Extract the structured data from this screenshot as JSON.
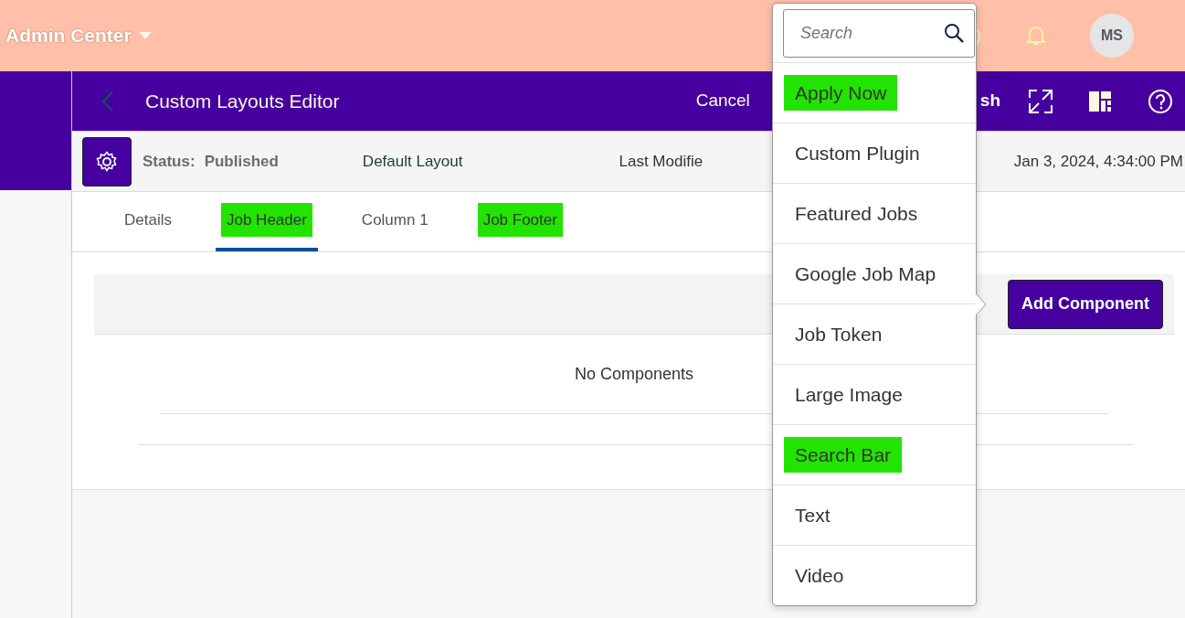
{
  "top_bar": {
    "title": "Admin Center",
    "avatar": "MS"
  },
  "editor_header": {
    "title": "Custom Layouts Editor",
    "cancel": "Cancel",
    "publish": "sh"
  },
  "status_row": {
    "status_label": "Status:",
    "status_value": "Published",
    "layout": "Default Layout",
    "modified_label": "Last Modifie",
    "modified_value": "Jan 3, 2024, 4:34:00 PM"
  },
  "tabs": [
    {
      "label": "Details",
      "selected": false,
      "highlighted": false
    },
    {
      "label": "Job Header",
      "selected": true,
      "highlighted": true
    },
    {
      "label": "Column 1",
      "selected": false,
      "highlighted": false
    },
    {
      "label": "Job Footer",
      "selected": false,
      "highlighted": true
    }
  ],
  "content": {
    "add_button": "Add Component",
    "empty_text": "No Components"
  },
  "component_menu": {
    "search": {
      "placeholder": "Search"
    },
    "items": [
      {
        "label": "Apply Now",
        "highlighted": true
      },
      {
        "label": "Custom Plugin",
        "highlighted": false
      },
      {
        "label": "Featured Jobs",
        "highlighted": false
      },
      {
        "label": "Google Job Map",
        "highlighted": false
      },
      {
        "label": "Job Token",
        "highlighted": false
      },
      {
        "label": "Large Image",
        "highlighted": false
      },
      {
        "label": "Search Bar",
        "highlighted": true
      },
      {
        "label": "Text",
        "highlighted": false
      },
      {
        "label": "Video",
        "highlighted": false
      }
    ]
  }
}
